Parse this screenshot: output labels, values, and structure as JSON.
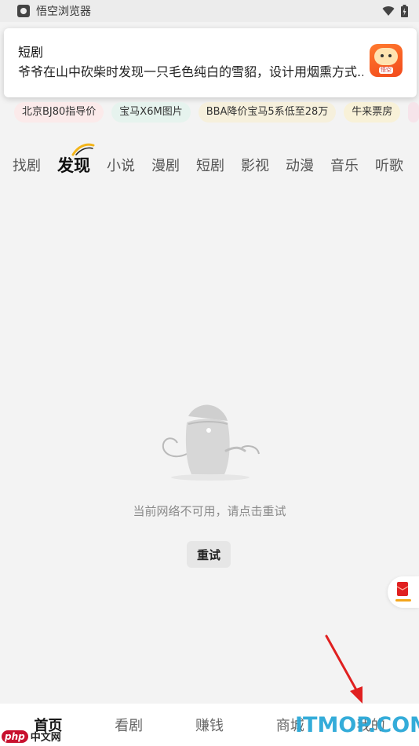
{
  "status_bar": {
    "app_name": "悟空浏览器",
    "icons": [
      "wifi-icon",
      "battery-icon"
    ]
  },
  "notification": {
    "title": "短剧",
    "body": "爷爷在山中砍柴时发现一只毛色纯白的雪貂，设计用烟熏方式...",
    "icon": "app-logo-icon",
    "logo_tag": "悟空"
  },
  "search_chips": [
    {
      "label": "北京BJ80指导价"
    },
    {
      "label": "宝马X6M图片"
    },
    {
      "label": "BBA降价宝马5系低至28万"
    },
    {
      "label": "牛来票房"
    }
  ],
  "tabs": [
    {
      "label": "找剧",
      "active": false
    },
    {
      "label": "发现",
      "active": true
    },
    {
      "label": "小说",
      "active": false
    },
    {
      "label": "漫剧",
      "active": false
    },
    {
      "label": "短剧",
      "active": false
    },
    {
      "label": "影视",
      "active": false
    },
    {
      "label": "动漫",
      "active": false
    },
    {
      "label": "音乐",
      "active": false
    },
    {
      "label": "听歌",
      "active": false
    }
  ],
  "empty_state": {
    "icon": "monkey-illustration-icon",
    "message": "当前网络不可用，请点击重试",
    "retry_label": "重试"
  },
  "float_widget": {
    "icon": "red-packet-icon"
  },
  "bottom_nav": [
    {
      "label": "首页",
      "active": true
    },
    {
      "label": "看剧",
      "active": false
    },
    {
      "label": "赚钱",
      "active": false
    },
    {
      "label": "商城",
      "active": false
    },
    {
      "label": "我的",
      "active": false
    }
  ],
  "watermarks": {
    "left_badge": "php",
    "left_text": "中文网",
    "right_text": "ITMOP.COM"
  },
  "colors": {
    "accent_red": "#e02020",
    "watermark_blue": "#2aa8d8",
    "swoosh_gold": "#f3b51b"
  }
}
